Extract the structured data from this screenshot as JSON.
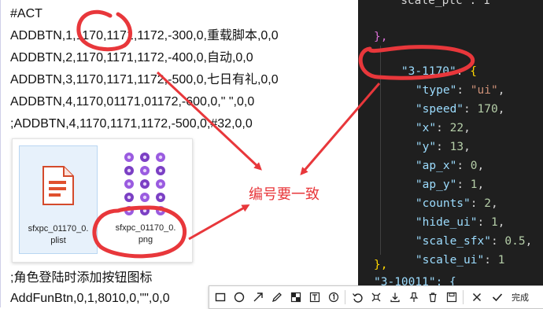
{
  "document": {
    "lines": [
      "#ACT",
      "ADDBTN,1,1170,1171,1172,-300,0,重载脚本,0,0",
      "ADDBTN,2,1170,1171,1172,-400,0,自动,0,0",
      "ADDBTN,3,1170,1171,1172,-500,0,七日有礼,0,0",
      "ADDBTN,4,1170,01171,01172,-600,0,\" \",0,0",
      ";ADDBTN,4,1170,1171,1172,-500,0,#32,0,0",
      ";角色登陆时添加按钮图标",
      "AddFunBtn,0,1,8010,0,\"\",0,0"
    ]
  },
  "files": [
    {
      "name_line1": "sfxpc_01170_0.",
      "name_line2": "plist",
      "icon": "plist-file-icon"
    },
    {
      "name_line1": "sfxpc_01170_0.",
      "name_line2": "png",
      "icon": "png-thumbnail-icon"
    }
  ],
  "code": {
    "lines": {
      "top_partial": "  \"scale_ptc\": 1",
      "close_prev": "},",
      "key": "\"3-1170\"",
      "type_key": "\"type\"",
      "type_val": "\"ui\"",
      "speed_key": "\"speed\"",
      "speed_val": "170",
      "x_key": "\"x\"",
      "x_val": "22",
      "y_key": "\"y\"",
      "y_val": "13",
      "ap_x_key": "\"ap_x\"",
      "ap_x_val": "0",
      "ap_y_key": "\"ap_y\"",
      "ap_y_val": "1",
      "counts_key": "\"counts\"",
      "counts_val": "2",
      "hide_ui_key": "\"hide_ui\"",
      "hide_ui_val": "1",
      "scale_sfx_key": "\"scale_sfx\"",
      "scale_sfx_val": "0.5",
      "scale_ui_key": "\"scale_ui\"",
      "scale_ui_val": "1",
      "close": "},",
      "next_key": "\"3-10011\": {"
    }
  },
  "annotation": {
    "label": "编号要一致",
    "color": "#e8373b"
  },
  "toolbar": {
    "icons": [
      "rectangle-icon",
      "ellipse-icon",
      "arrow-icon",
      "pen-icon",
      "mosaic-icon",
      "text-icon",
      "number-icon",
      "undo-icon",
      "crop-icon",
      "download-icon",
      "pin-icon",
      "delete-icon",
      "close-icon",
      "check-icon"
    ],
    "done_label": "完成"
  }
}
